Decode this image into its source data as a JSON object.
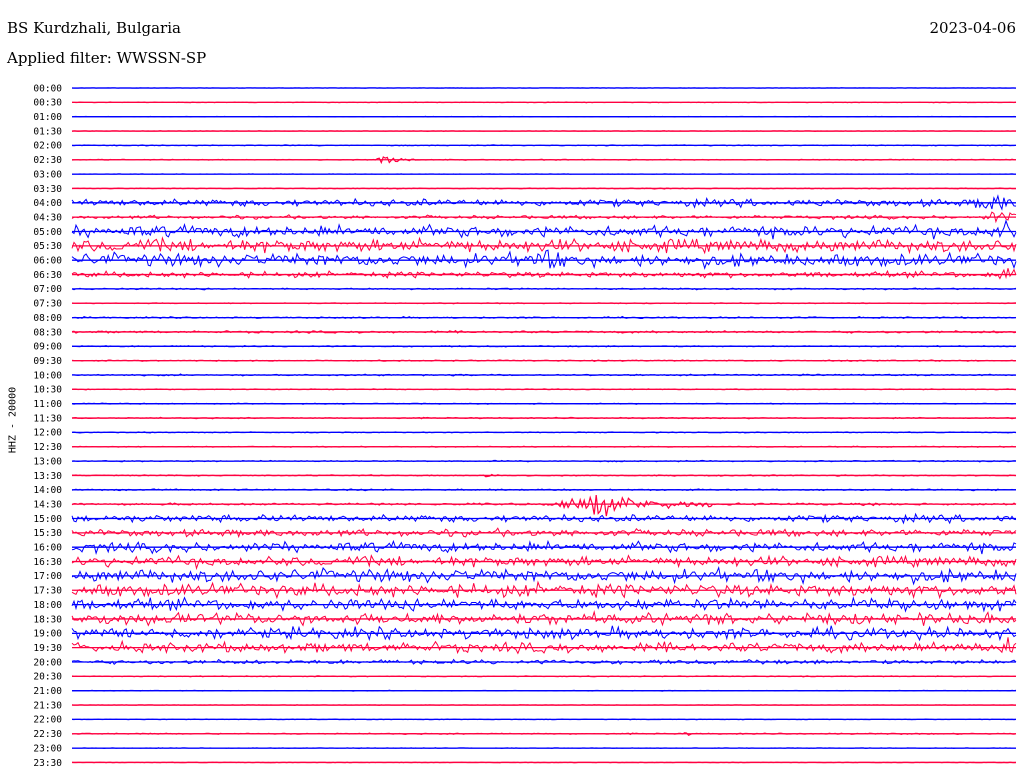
{
  "header": {
    "station": "BS Kurdzhali, Bulgaria",
    "date": "2023-04-06",
    "filter": "Applied filter: WWSSN-SP"
  },
  "channel_label": "HHZ - 20000",
  "colors": {
    "blue": "#0000ff",
    "red": "#ff0040"
  },
  "chart_data": {
    "type": "line",
    "title": "BS Kurdzhali, Bulgaria",
    "subtitle": "Applied filter: WWSSN-SP",
    "ylabel": "HHZ - 20000",
    "y_tick_labels": [
      "00:00",
      "00:30",
      "01:00",
      "01:30",
      "02:00",
      "02:30",
      "03:00",
      "03:30",
      "04:00",
      "04:30",
      "05:00",
      "05:30",
      "06:00",
      "06:30",
      "07:00",
      "07:30",
      "08:00",
      "08:30",
      "09:00",
      "09:30",
      "10:00",
      "10:30",
      "11:00",
      "11:30",
      "12:00",
      "12:30",
      "13:00",
      "13:30",
      "14:00",
      "14:30",
      "15:00",
      "15:30",
      "16:00",
      "16:30",
      "17:00",
      "17:30",
      "18:00",
      "18:30",
      "19:00",
      "19:30",
      "20:00",
      "20:30",
      "21:00",
      "21:30",
      "22:00",
      "22:30",
      "23:00",
      "23:30"
    ],
    "trace_colors_alternating": [
      "blue",
      "red"
    ],
    "noise_level_per_trace": [
      0.3,
      0.4,
      0.3,
      0.4,
      0.6,
      0.6,
      0.3,
      0.6,
      5,
      2.5,
      8,
      9,
      9,
      4,
      1,
      0.6,
      1,
      1.5,
      0.8,
      0.8,
      1,
      0.6,
      0.6,
      0.8,
      0.6,
      0.6,
      0.8,
      0.8,
      1,
      1.5,
      5,
      5,
      7,
      7,
      9,
      9,
      8,
      8,
      8,
      7,
      3,
      0.6,
      0.4,
      0.4,
      0.4,
      0.8,
      0.4,
      0.4
    ],
    "events": [
      {
        "trace": "02:30",
        "x": 0.33,
        "amplitude": 8,
        "width": 0.03
      },
      {
        "trace": "06:00",
        "x": 0.49,
        "amplitude": 12,
        "width": 0.03
      },
      {
        "trace": "04:00",
        "x": 0.97,
        "amplitude": 12,
        "width": 0.04
      },
      {
        "trace": "04:30",
        "x": 0.98,
        "amplitude": 10,
        "width": 0.04
      },
      {
        "trace": "05:00",
        "x": 0.98,
        "amplitude": 12,
        "width": 0.03
      },
      {
        "trace": "06:30",
        "x": 0.99,
        "amplitude": 14,
        "width": 0.03
      },
      {
        "trace": "14:30",
        "x": 0.55,
        "amplitude": 16,
        "width": 0.12
      },
      {
        "trace": "19:30",
        "x": 0.99,
        "amplitude": 16,
        "width": 0.03
      },
      {
        "trace": "13:30",
        "x": 0.44,
        "amplitude": 4,
        "width": 0.01
      },
      {
        "trace": "22:30",
        "x": 0.65,
        "amplitude": 4,
        "width": 0.005
      }
    ]
  }
}
